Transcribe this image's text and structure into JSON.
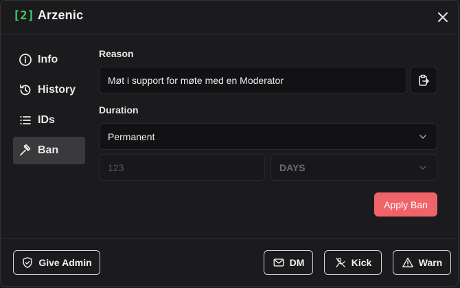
{
  "header": {
    "id_tag": "[2]",
    "player_name": "Arzenic",
    "close_icon": "close-icon"
  },
  "sidebar": {
    "items": [
      {
        "label": "Info",
        "icon": "info-icon",
        "active": false
      },
      {
        "label": "History",
        "icon": "history-icon",
        "active": false
      },
      {
        "label": "IDs",
        "icon": "list-icon",
        "active": false
      },
      {
        "label": "Ban",
        "icon": "gavel-icon",
        "active": true
      }
    ]
  },
  "ban": {
    "reason_label": "Reason",
    "reason_value": "Møt i support for møte med en Moderator",
    "duration_label": "Duration",
    "duration_value": "Permanent",
    "amount_placeholder": "123",
    "unit_value": "DAYS",
    "apply_label": "Apply Ban",
    "apply_color": "#f06469"
  },
  "footer": {
    "give_admin_label": "Give Admin",
    "dm_label": "DM",
    "kick_label": "Kick",
    "warn_label": "Warn"
  },
  "colors": {
    "background": "#1b1b1d",
    "id_accent": "#3ecf70",
    "active_nav": "#3a3a3d"
  }
}
